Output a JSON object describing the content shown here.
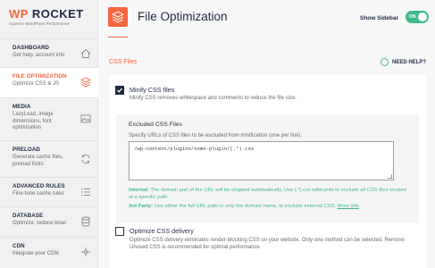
{
  "logo": {
    "brand_wp": "WP",
    "brand_rocket": "ROCKET",
    "tagline": "Superior WordPress Performance"
  },
  "sidebar": {
    "items": [
      {
        "title": "DASHBOARD",
        "desc": "Get help, account info",
        "icon": "home-icon"
      },
      {
        "title": "FILE OPTIMIZATION",
        "desc": "Optimize CSS & JS",
        "icon": "layers-icon"
      },
      {
        "title": "MEDIA",
        "desc": "LazyLoad, image dimensions, font optimization",
        "icon": "image-icon"
      },
      {
        "title": "PRELOAD",
        "desc": "Generate cache files, preload fonts",
        "icon": "refresh-icon"
      },
      {
        "title": "ADVANCED RULES",
        "desc": "Fine-tune cache rules",
        "icon": "list-icon"
      },
      {
        "title": "DATABASE",
        "desc": "Optimize, reduce bloat",
        "icon": "database-icon"
      },
      {
        "title": "CDN",
        "desc": "Integrate your CDN",
        "icon": "cdn-icon"
      }
    ]
  },
  "header": {
    "title": "File Optimization",
    "show_sidebar_label": "Show Sidebar",
    "toggle_state": "ON"
  },
  "section": {
    "title": "CSS Files",
    "help_label": "NEED HELP?"
  },
  "minify": {
    "title": "Minify CSS files",
    "desc": "Minify CSS removes whitespace and comments to reduce the file size.",
    "checked": true
  },
  "excluded": {
    "title": "Excluded CSS Files",
    "desc": "Specify URLs of CSS files to be excluded from minification (one per line).",
    "value": "/wp-content/plugins/some-plugin/(.*).css",
    "internal_label": "Internal:",
    "internal_text": " The domain part of the URL will be stripped automatically. Use (.*).css wildcards to exclude all CSS files located at a specific path.",
    "third_label": "3rd Party:",
    "third_text": " Use either the full URL path or only the domain name, to exclude external CSS. ",
    "more_info": "More info"
  },
  "optimize": {
    "title": "Optimize CSS delivery",
    "desc": "Optimize CSS delivery eliminates render-blocking CSS on your website. Only one method can be selected. Remove Unused CSS is recommended for optimal performance.",
    "checked": false
  },
  "colors": {
    "accent": "#f56640",
    "green": "#3fba8a",
    "navy": "#1f2a44"
  }
}
